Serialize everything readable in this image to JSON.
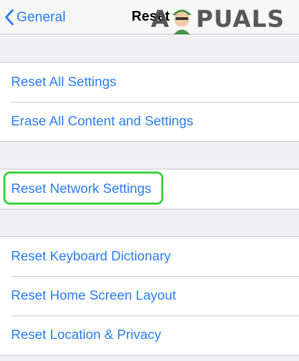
{
  "navbar": {
    "back_label": "General",
    "title": "Reset"
  },
  "watermark": {
    "text_left": "A",
    "text_right": "PUALS"
  },
  "groups": [
    {
      "items": [
        "Reset All Settings",
        "Erase All Content and Settings"
      ]
    },
    {
      "items": [
        "Reset Network Settings"
      ]
    },
    {
      "items": [
        "Reset Keyboard Dictionary",
        "Reset Home Screen Layout",
        "Reset Location & Privacy"
      ]
    }
  ],
  "colors": {
    "accent": "#2a7cf6",
    "highlight": "#39d33a",
    "background": "#efeff4",
    "separator": "#c8c7cc"
  }
}
